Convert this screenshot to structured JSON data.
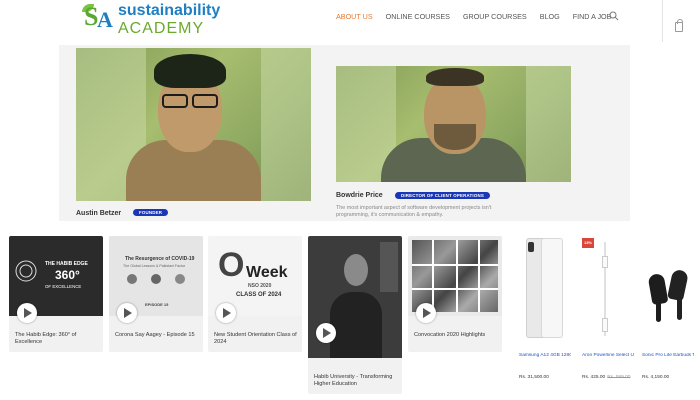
{
  "brand": {
    "line1": "sustainability",
    "line2": "ACADEMY",
    "mark_s": "S",
    "mark_a": "A"
  },
  "nav": {
    "items": [
      "ABOUT US",
      "ONLINE COURSES",
      "GROUP COURSES",
      "BLOG",
      "FIND A JOB"
    ],
    "active": "ABOUT US"
  },
  "team": [
    {
      "name": "Austin Betzer",
      "role": "FOUNDER"
    },
    {
      "name": "Bowdrie Price",
      "role": "DIRECTOR OF CLIENT OPERATIONS",
      "bio": [
        "The most important aspect of software development projects isn't",
        "programming, it's communication & empathy."
      ]
    }
  ],
  "videos": [
    {
      "title": [
        "The Habib Edge: 360° of",
        "Excellence"
      ],
      "thumb_text": [
        "THE HABIB EDGE",
        "360°",
        "OF EXCELLENCE"
      ]
    },
    {
      "title": [
        "Corona Say Aagey - Episode 15"
      ],
      "thumb_text": [
        "The Resurgence of COVID-19",
        "The Global Lessons & Pakistani Factor",
        "EPISODE 15"
      ]
    },
    {
      "title": [
        "New Student Orientation Class of",
        "2024"
      ],
      "thumb_text": [
        "O",
        "Week",
        "NSO 2020",
        "CLASS OF 2024"
      ]
    },
    {
      "title": [
        "Habib University - Transforming",
        "Higher Education"
      ],
      "thumb_text": []
    },
    {
      "title": [
        "Convocation 2020 Highlights"
      ],
      "thumb_text": []
    }
  ],
  "products": [
    {
      "name": "Samsung A12 4GB 128GB White Smartphone",
      "price": "Rs. 31,500.00",
      "old_price": ""
    },
    {
      "name": "Aron Powerline Select USB-C Cable 1.2m",
      "price": "Rs. 425.00",
      "old_price": "Rs. 599.00",
      "tag": "13%"
    },
    {
      "name": "Sonic Pro Lite Earbuds TWS Bluetooth Earphones Black",
      "price": "Rs. 4,150.00",
      "old_price": ""
    }
  ],
  "colors": {
    "accent_orange": "#e8772e",
    "badge_blue": "#1a37b8",
    "link_blue": "#1a55c4",
    "logo_green": "#6aaa2e"
  },
  "icons": {
    "search": "search-icon",
    "cart": "shopping-bag-icon",
    "play": "play-icon"
  }
}
